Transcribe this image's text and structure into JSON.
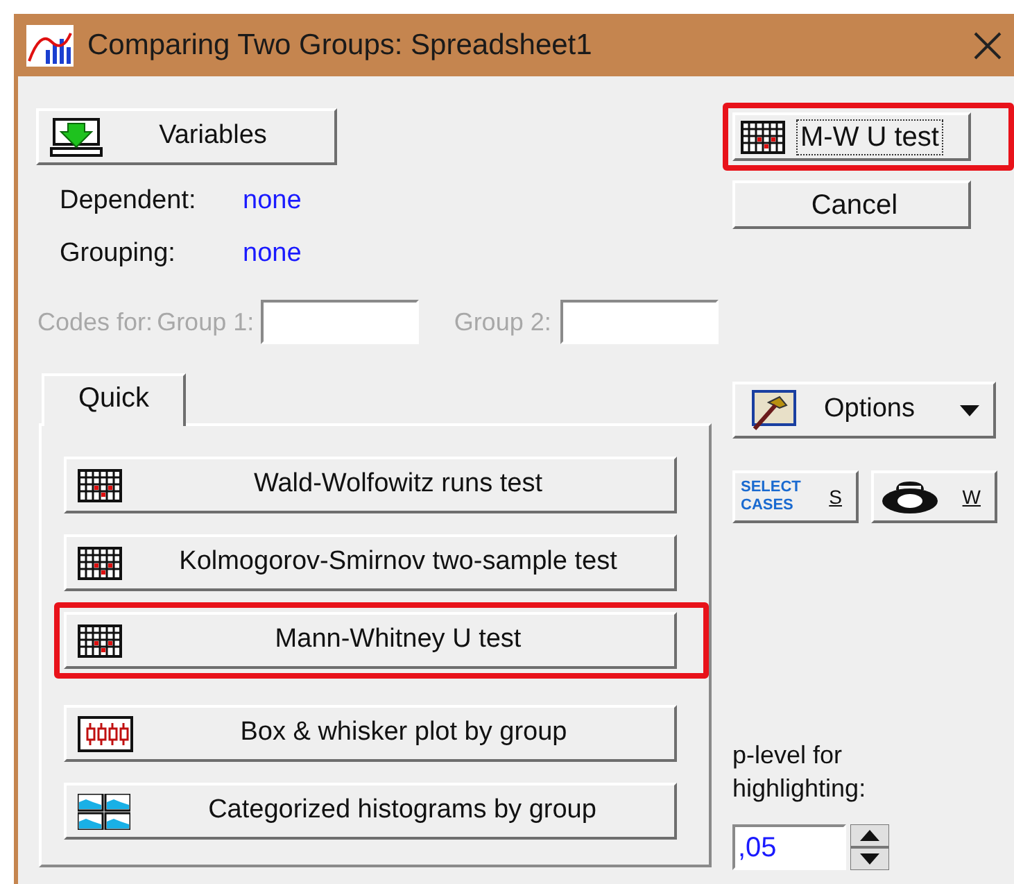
{
  "window": {
    "title": "Comparing Two Groups: Spreadsheet1"
  },
  "variables_button": {
    "label": "Variables"
  },
  "variables": [
    {
      "label": "Dependent:",
      "value": "none"
    },
    {
      "label": "Grouping:",
      "value": "none"
    }
  ],
  "codes": {
    "label": "Codes for:",
    "disabled": true,
    "fields": [
      {
        "label": "Group 1:"
      },
      {
        "label": "Group 2:"
      }
    ]
  },
  "tabs": [
    {
      "label": "Quick",
      "selected": true
    }
  ],
  "quick_buttons": [
    {
      "kind": "grid",
      "label": "Wald-Wolfowitz runs test",
      "highlighted": false
    },
    {
      "kind": "grid",
      "label": "Kolmogorov-Smirnov two-sample test",
      "highlighted": false
    },
    {
      "kind": "grid",
      "label": "Mann-Whitney U test",
      "highlighted": true
    },
    {
      "kind": "boxplot",
      "label": "Box & whisker plot by group",
      "highlighted": false
    },
    {
      "kind": "histograms",
      "label": "Categorized histograms by group",
      "highlighted": false
    }
  ],
  "side_buttons": [
    {
      "kind": "grid",
      "label": "M-W U test",
      "highlighted": true
    },
    {
      "kind": "plain",
      "label": "Cancel",
      "highlighted": false
    }
  ],
  "options_button": {
    "label": "Options"
  },
  "small_buttons": [
    {
      "kind": "select-cases",
      "icon_text": "SELECT CASES",
      "label": "S"
    },
    {
      "kind": "weight",
      "label": "W"
    }
  ],
  "p_level": {
    "label": "p-level for highlighting:",
    "value": ",05"
  }
}
